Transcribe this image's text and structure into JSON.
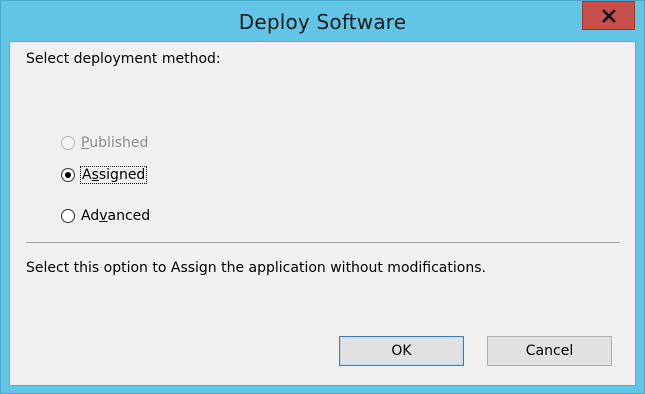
{
  "window": {
    "title": "Deploy Software"
  },
  "form": {
    "prompt": "Select deployment method:",
    "options": [
      {
        "pre": "",
        "mnemonic": "P",
        "post": "ublished",
        "state": "disabled",
        "selected": false
      },
      {
        "pre": "A",
        "mnemonic": "s",
        "post": "signed",
        "state": "enabled",
        "selected": true
      },
      {
        "pre": "Ad",
        "mnemonic": "v",
        "post": "anced",
        "state": "enabled",
        "selected": false
      }
    ],
    "description": "Select this option to Assign the application without modifications."
  },
  "buttons": {
    "ok_label": "OK",
    "cancel_label": "Cancel"
  },
  "icons": {
    "close": "close-icon"
  },
  "colors": {
    "titlebar": "#62c5e6",
    "close_button": "#c7504c",
    "client_bg": "#f0f0f0"
  }
}
